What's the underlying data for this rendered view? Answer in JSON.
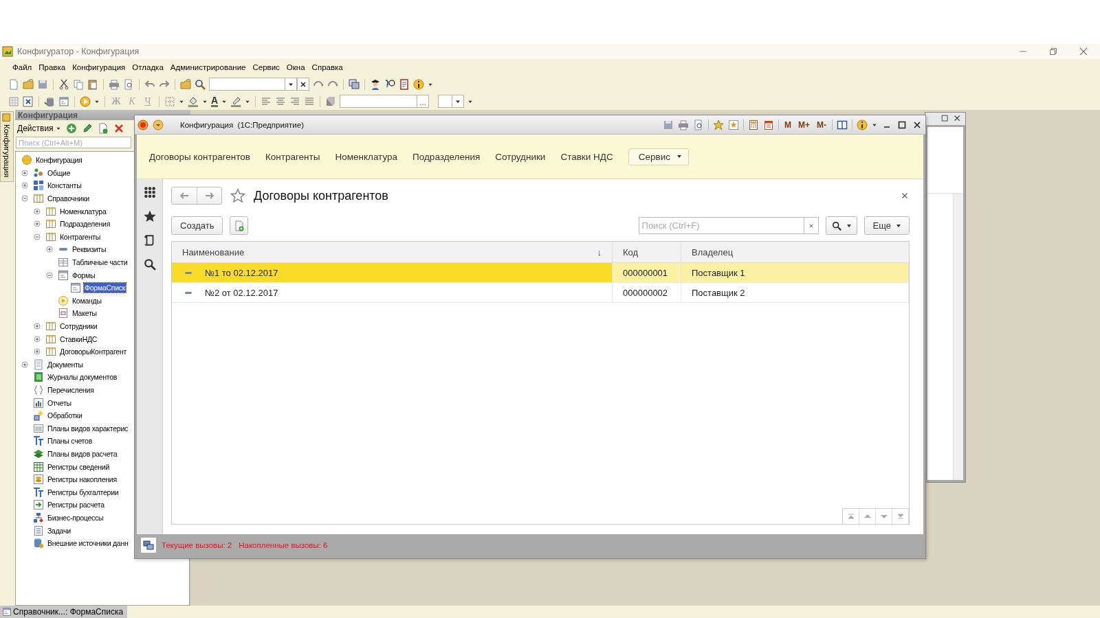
{
  "app": {
    "title": "Конфигуратор - Конфигурация"
  },
  "menu": [
    {
      "label": "Файл"
    },
    {
      "label": "Правка"
    },
    {
      "label": "Конфигурация"
    },
    {
      "label": "Отладка"
    },
    {
      "label": "Администрирование"
    },
    {
      "label": "Сервис"
    },
    {
      "label": "Окна"
    },
    {
      "label": "Справка"
    }
  ],
  "toolbar": {
    "format_buttons": [
      {
        "label": "Ж",
        "disabled": true
      },
      {
        "label": "К",
        "disabled": true
      },
      {
        "label": "Ч",
        "disabled": true
      }
    ],
    "font_color_label": "A",
    "field_button": "..."
  },
  "config_panel": {
    "tab_label": "Конфигурация",
    "title": "Конфигурация",
    "actions_label": "Действия",
    "search": {
      "placeholder": "Поиск (Ctrl+Alt+M)"
    },
    "tree": [
      {
        "label": "Конфигурация",
        "kind": "root",
        "selected": false,
        "children": [
          {
            "label": "Общие",
            "kind": "common",
            "expanded": false,
            "selected": false
          },
          {
            "label": "Константы",
            "kind": "constants",
            "expanded": false,
            "selected": false
          },
          {
            "label": "Справочники",
            "kind": "catalog",
            "expanded": true,
            "selected": false,
            "children": [
              {
                "label": "Номенклатура",
                "kind": "catalog",
                "expanded": false,
                "selected": false
              },
              {
                "label": "Подразделения",
                "kind": "catalog",
                "expanded": false,
                "selected": false
              },
              {
                "label": "Контрагенты",
                "kind": "catalog",
                "expanded": true,
                "selected": false,
                "children": [
                  {
                    "label": "Реквизиты",
                    "kind": "attribute",
                    "expanded": false,
                    "selected": false
                  },
                  {
                    "label": "Табличные части",
                    "kind": "tabular",
                    "selected": false
                  },
                  {
                    "label": "Формы",
                    "kind": "form",
                    "expanded": true,
                    "selected": false,
                    "children": [
                      {
                        "label": "ФормаСписк",
                        "kind": "form",
                        "selected": true
                      }
                    ]
                  },
                  {
                    "label": "Команды",
                    "kind": "command",
                    "selected": false
                  },
                  {
                    "label": "Макеты",
                    "kind": "template",
                    "selected": false
                  }
                ]
              },
              {
                "label": "Сотрудники",
                "kind": "catalog",
                "expanded": false,
                "selected": false
              },
              {
                "label": "СтавкиНДС",
                "kind": "catalog",
                "expanded": false,
                "selected": false
              },
              {
                "label": "ДоговорыКонтрагент",
                "kind": "catalog",
                "expanded": false,
                "selected": false
              }
            ]
          },
          {
            "label": "Документы",
            "kind": "document",
            "expanded": false,
            "selected": false
          },
          {
            "label": "Журналы документов",
            "kind": "journal",
            "selected": false
          },
          {
            "label": "Перечисления",
            "kind": "enum",
            "selected": false
          },
          {
            "label": "Отчеты",
            "kind": "report",
            "selected": false
          },
          {
            "label": "Обработки",
            "kind": "processing",
            "selected": false
          },
          {
            "label": "Планы видов характерис",
            "kind": "grid",
            "selected": false
          },
          {
            "label": "Планы счетов",
            "kind": "accounts",
            "selected": false
          },
          {
            "label": "Планы видов расчета",
            "kind": "layers",
            "selected": false
          },
          {
            "label": "Регистры сведений",
            "kind": "table",
            "selected": false
          },
          {
            "label": "Регистры накопления",
            "kind": "coins",
            "selected": false
          },
          {
            "label": "Регистры бухгалтерии",
            "kind": "accounts",
            "selected": false
          },
          {
            "label": "Регистры расчета",
            "kind": "calc",
            "selected": false
          },
          {
            "label": "Бизнес-процессы",
            "kind": "process",
            "selected": false
          },
          {
            "label": "Задачи",
            "kind": "task",
            "selected": false
          },
          {
            "label": "Внешние источники данн",
            "kind": "external",
            "selected": false
          }
        ]
      }
    ]
  },
  "window": {
    "title": "Конфигурация  (1С:Предприятие)",
    "memory_buttons": [
      "M",
      "M+",
      "M-"
    ],
    "sections": [
      {
        "label": "Договоры контрагентов",
        "kind": "link"
      },
      {
        "label": "Контрагенты",
        "kind": "link"
      },
      {
        "label": "Номенклатура",
        "kind": "link"
      },
      {
        "label": "Подразделения",
        "kind": "link"
      },
      {
        "label": "Сотрудники",
        "kind": "link"
      },
      {
        "label": "Ставки НДС",
        "kind": "link"
      },
      {
        "label": "Сервис",
        "kind": "menu"
      }
    ],
    "form": {
      "title": "Договоры контрагентов",
      "create_label": "Создать",
      "search": {
        "placeholder": "Поиск (Ctrl+F)"
      },
      "more_label": "Еще",
      "table": {
        "columns": [
          {
            "label": "Наименование",
            "sort": "↓"
          },
          {
            "label": "Код"
          },
          {
            "label": "Владелец"
          }
        ],
        "rows": [
          {
            "cells": [
              "№1 то 02.12.2017",
              "000000001",
              "Поставщик 1"
            ],
            "selected": true
          },
          {
            "cells": [
              "№2 от 02.12.2017",
              "000000002",
              "Поставщик 2"
            ],
            "selected": false
          }
        ]
      }
    },
    "status": [
      "Текущие вызовы: 2",
      "Накопленные вызовы: 6"
    ]
  },
  "taskbar": [
    {
      "label": "Справочник...: ФормаСписка"
    }
  ]
}
